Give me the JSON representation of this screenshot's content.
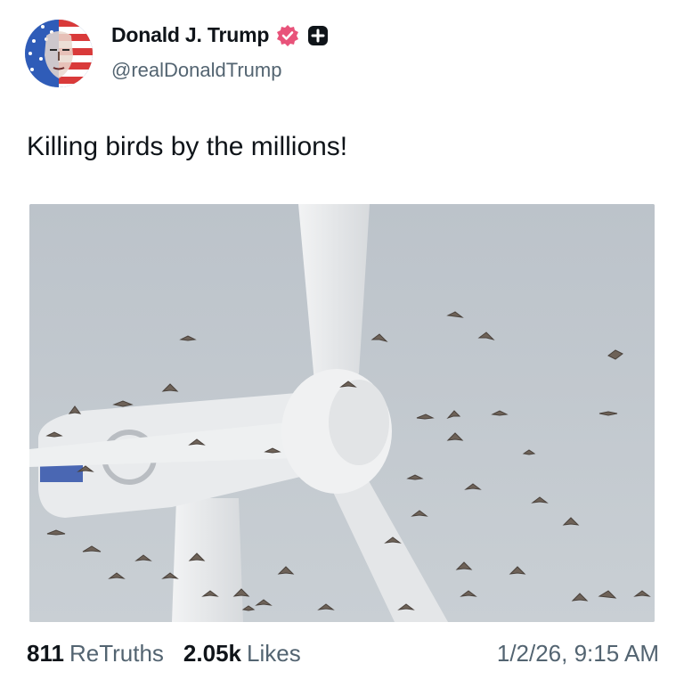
{
  "author": {
    "name": "Donald J. Trump",
    "handle": "@realDonaldTrump",
    "avatar_icon": "flag-portrait-avatar",
    "verified_color": "#e8537a"
  },
  "post": {
    "text": "Killing birds by the millions!",
    "image_description_icon": "wind-turbine-with-birds-photo"
  },
  "stats": {
    "retruths_count": "811",
    "retruths_label": "ReTruths",
    "likes_count": "2.05k",
    "likes_label": "Likes"
  },
  "timestamp": "1/2/26, 9:15 AM",
  "colors": {
    "text_primary": "#0f1419",
    "text_secondary": "#536471",
    "sky": "#c3c9cf"
  }
}
